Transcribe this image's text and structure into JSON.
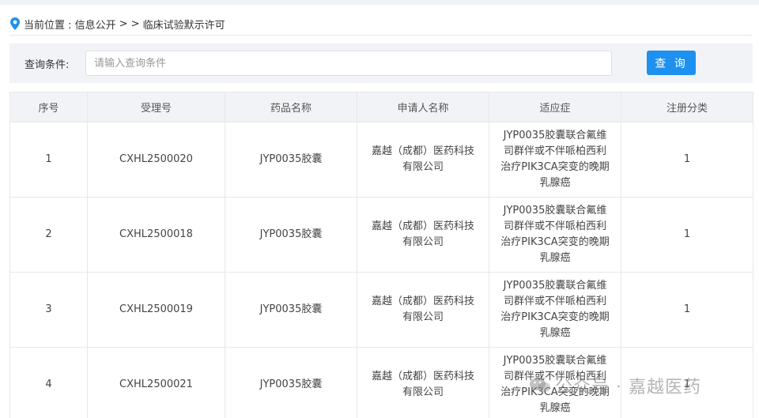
{
  "breadcrumb": {
    "prefix": "当前位置 : 信息公开",
    "separator": "> >",
    "current": "临床试验默示许可"
  },
  "search": {
    "label": "查询条件:",
    "placeholder": "请输入查询条件",
    "value": "",
    "button_label": "查 询"
  },
  "table": {
    "columns": [
      "序号",
      "受理号",
      "药品名称",
      "申请人名称",
      "适应症",
      "注册分类"
    ],
    "rows": [
      {
        "index": "1",
        "accept_no": "CXHL2500020",
        "drug": "JYP0035胶囊",
        "applicant": "嘉越（成都）医药科技有限公司",
        "indication": "JYP0035胶囊联合氟维司群伴或不伴哌柏西利治疗PIK3CA突变的晚期乳腺癌",
        "category": "1"
      },
      {
        "index": "2",
        "accept_no": "CXHL2500018",
        "drug": "JYP0035胶囊",
        "applicant": "嘉越（成都）医药科技有限公司",
        "indication": "JYP0035胶囊联合氟维司群伴或不伴哌柏西利治疗PIK3CA突变的晚期乳腺癌",
        "category": "1"
      },
      {
        "index": "3",
        "accept_no": "CXHL2500019",
        "drug": "JYP0035胶囊",
        "applicant": "嘉越（成都）医药科技有限公司",
        "indication": "JYP0035胶囊联合氟维司群伴或不伴哌柏西利治疗PIK3CA突变的晚期乳腺癌",
        "category": "1"
      },
      {
        "index": "4",
        "accept_no": "CXHL2500021",
        "drug": "JYP0035胶囊",
        "applicant": "嘉越（成都）医药科技有限公司",
        "indication": "JYP0035胶囊联合氟维司群伴或不伴哌柏西利治疗PIK3CA突变的晚期乳腺癌",
        "category": "1"
      }
    ]
  },
  "watermark": {
    "text": "公众号 · 嘉越医药"
  },
  "colors": {
    "accent": "#1e90f0",
    "header_bg": "#f2f3f6",
    "border": "#e8e8e8",
    "pin_icon": "#1e90f0"
  },
  "icons": {
    "breadcrumb": "location-pin-icon",
    "watermark": "wechat-icon"
  }
}
